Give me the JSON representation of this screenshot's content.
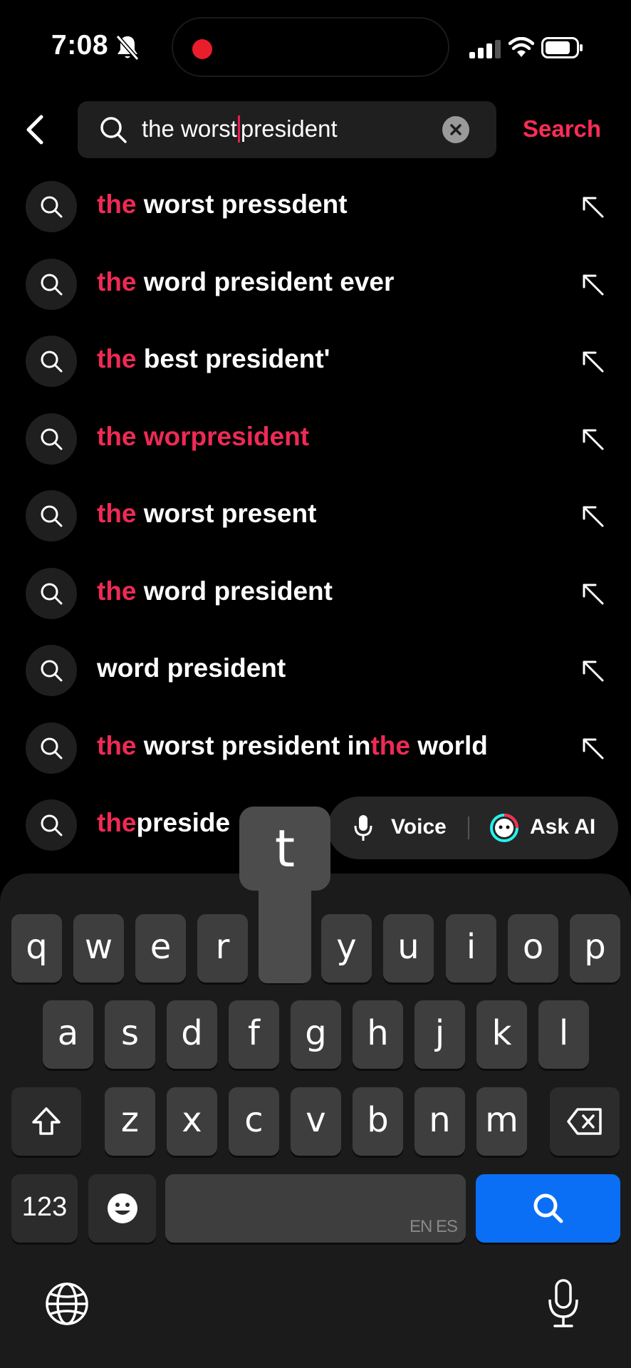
{
  "status_bar": {
    "time": "7:08",
    "icons": [
      "bell-slash-icon",
      "signal-icon",
      "wifi-icon",
      "battery-icon"
    ],
    "recording_indicator_color": "#ea1d2c"
  },
  "header": {
    "query_before_cursor": "the worst",
    "query_after_cursor": "president",
    "search_label": "Search",
    "accent_color": "#fe2c55"
  },
  "suggestions": [
    {
      "parts": [
        {
          "t": "the",
          "hl": true
        },
        {
          "t": " worst pressdent",
          "hl": false
        }
      ]
    },
    {
      "parts": [
        {
          "t": "the",
          "hl": true
        },
        {
          "t": " word president ever",
          "hl": false
        }
      ]
    },
    {
      "parts": [
        {
          "t": "the",
          "hl": true
        },
        {
          "t": " best president'",
          "hl": false
        }
      ]
    },
    {
      "parts": [
        {
          "t": "the",
          "hl": true
        },
        {
          "t": " worpresident",
          "hl": true
        }
      ]
    },
    {
      "parts": [
        {
          "t": "the",
          "hl": true
        },
        {
          "t": " worst present",
          "hl": false
        }
      ]
    },
    {
      "parts": [
        {
          "t": "the",
          "hl": true
        },
        {
          "t": " word president",
          "hl": false
        }
      ]
    },
    {
      "parts": [
        {
          "t": "word president",
          "hl": false
        }
      ]
    },
    {
      "parts": [
        {
          "t": "the",
          "hl": true
        },
        {
          "t": " worst president in",
          "hl": false
        },
        {
          "t": "the",
          "hl": true
        },
        {
          "t": " world",
          "hl": false
        }
      ]
    },
    {
      "parts": [
        {
          "t": "the",
          "hl": true
        },
        {
          "t": "preside",
          "hl": false
        }
      ]
    }
  ],
  "assist_pill": {
    "voice_label": "Voice",
    "ai_label": "Ask AI"
  },
  "keyboard": {
    "popup_key": "t",
    "row1": [
      "q",
      "w",
      "e",
      "r",
      "t",
      "y",
      "u",
      "i",
      "o",
      "p"
    ],
    "row2": [
      "a",
      "s",
      "d",
      "f",
      "g",
      "h",
      "j",
      "k",
      "l"
    ],
    "row3": [
      "z",
      "x",
      "c",
      "v",
      "b",
      "n",
      "m"
    ],
    "numbers_label": "123",
    "space_languages": "EN ES",
    "return_key_icon": "search-icon",
    "bottom_icons": [
      "globe-icon",
      "microphone-icon"
    ]
  }
}
